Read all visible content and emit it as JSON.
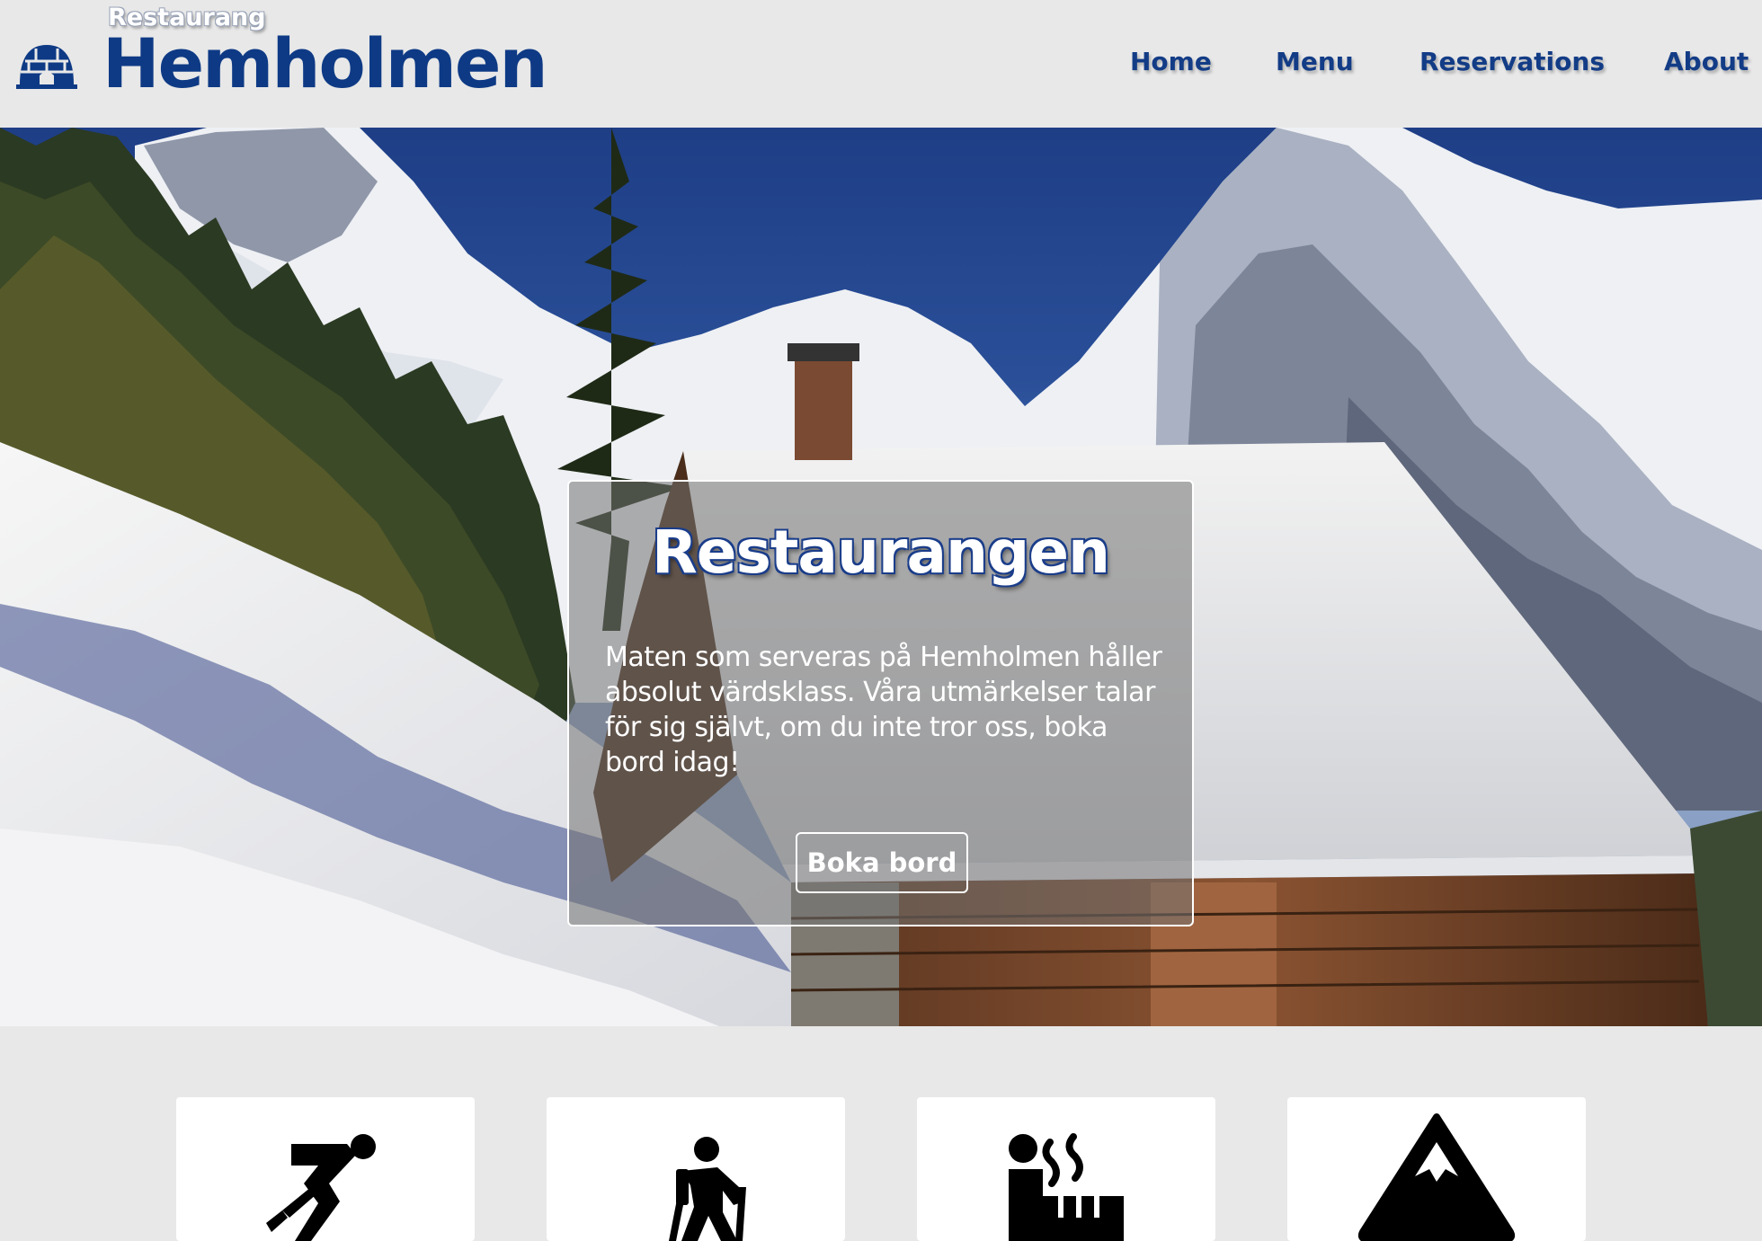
{
  "brand": {
    "small_label": "Restaurang",
    "name": "Hemholmen",
    "logo_icon": "igloo-icon",
    "color": "#0e3a85"
  },
  "nav": {
    "items": [
      {
        "label": "Home"
      },
      {
        "label": "Menu"
      },
      {
        "label": "Reservations"
      },
      {
        "label": "About"
      }
    ]
  },
  "hero": {
    "title": "Restaurangen",
    "text": "Maten som serveras på Hemholmen håller absolut värdsklass. Våra utmärkelser talar för sig självt, om du inte tror oss, boka bord idag!",
    "button_label": "Boka bord"
  },
  "cards": [
    {
      "icon": "skating-icon"
    },
    {
      "icon": "hiking-icon"
    },
    {
      "icon": "sauna-icon"
    },
    {
      "icon": "mountain-icon"
    }
  ]
}
